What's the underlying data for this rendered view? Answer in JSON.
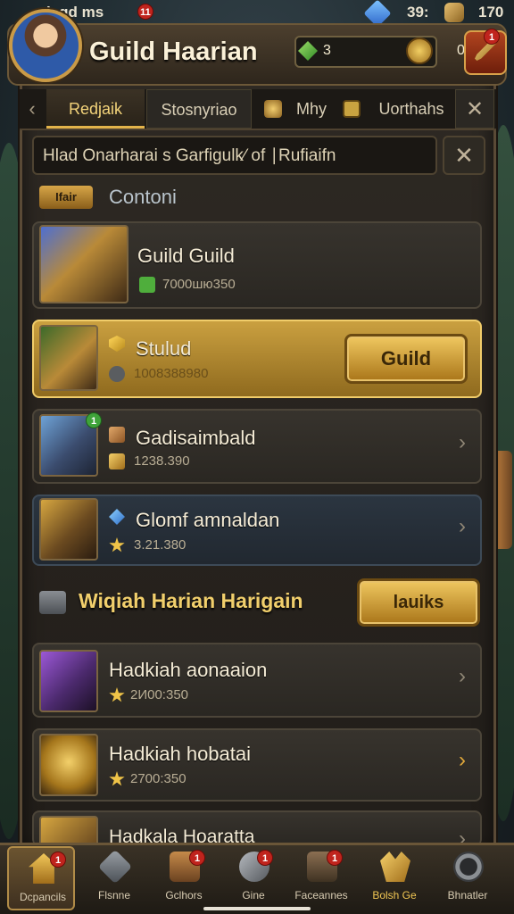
{
  "statusbar": {
    "left_text": "laqd ms",
    "left_badge": "11",
    "gems": "39:",
    "bag": "170"
  },
  "header": {
    "title": "Guild Haarian",
    "resource_value": "3",
    "coin_value": "0",
    "corner_badge": "1"
  },
  "tabs": [
    {
      "label": "Redjaik"
    },
    {
      "label": "Stosnyriao"
    },
    {
      "label": "Mhy"
    },
    {
      "label": "Uorthahs"
    }
  ],
  "search": {
    "value": "Hlad Onarharai s Garfigulk⁄ of ∣Rufiaifn"
  },
  "section1": {
    "tag": "Ifair",
    "title": "Contoni"
  },
  "cards": [
    {
      "title": "Guild Guild",
      "sub": "7000шю350",
      "style": "dark"
    },
    {
      "title": "Stulud",
      "sub": "1008388980",
      "style": "gold",
      "button": "Guild"
    },
    {
      "title": "Gadisaimbald",
      "sub": "1238.390",
      "style": "dark",
      "badge": "1"
    },
    {
      "title": "Glomf amnaldan",
      "sub": "3.21.380",
      "style": "blue"
    }
  ],
  "section2": {
    "title": "Wiqiah Harian Harigain",
    "button": "lauiks"
  },
  "cards2": [
    {
      "title": "Hadkiah aonaaion",
      "sub": "2И00:350"
    },
    {
      "title": "Hadkiah hobatai",
      "sub": "2700:350"
    },
    {
      "title": "Hadkala Hoaratta",
      "sub": ""
    }
  ],
  "nav": [
    {
      "label": "Dcpancils",
      "badge": "1"
    },
    {
      "label": "Flsnne",
      "badge": ""
    },
    {
      "label": "Gclhors",
      "badge": "1"
    },
    {
      "label": "Gine",
      "badge": "1"
    },
    {
      "label": "Faceannes",
      "badge": "1"
    },
    {
      "label": "Bolsh Ge",
      "badge": ""
    },
    {
      "label": "Bhnatler",
      "badge": ""
    }
  ],
  "colors": {
    "accent_gold": "#e3b34a",
    "badge_red": "#c0241d",
    "panel_bg": "#2f2a24"
  }
}
